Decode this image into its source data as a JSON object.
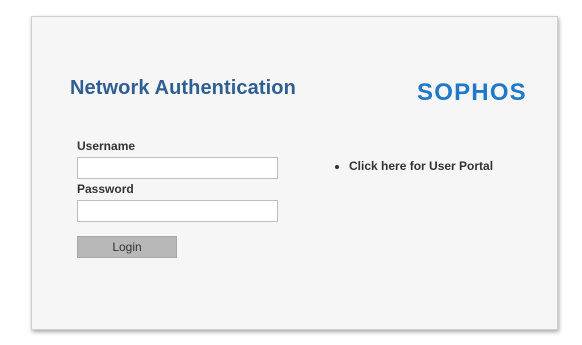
{
  "header": {
    "title": "Network Authentication",
    "logo_text": "SOPHOS"
  },
  "form": {
    "username_label": "Username",
    "username_value": "",
    "password_label": "Password",
    "password_value": "",
    "login_label": "Login"
  },
  "links": {
    "user_portal": "Click here for User Portal"
  },
  "colors": {
    "title": "#2f5e93",
    "logo": "#1f78c8",
    "card_bg": "#f6f6f6",
    "button_bg": "#b8b8b8"
  }
}
